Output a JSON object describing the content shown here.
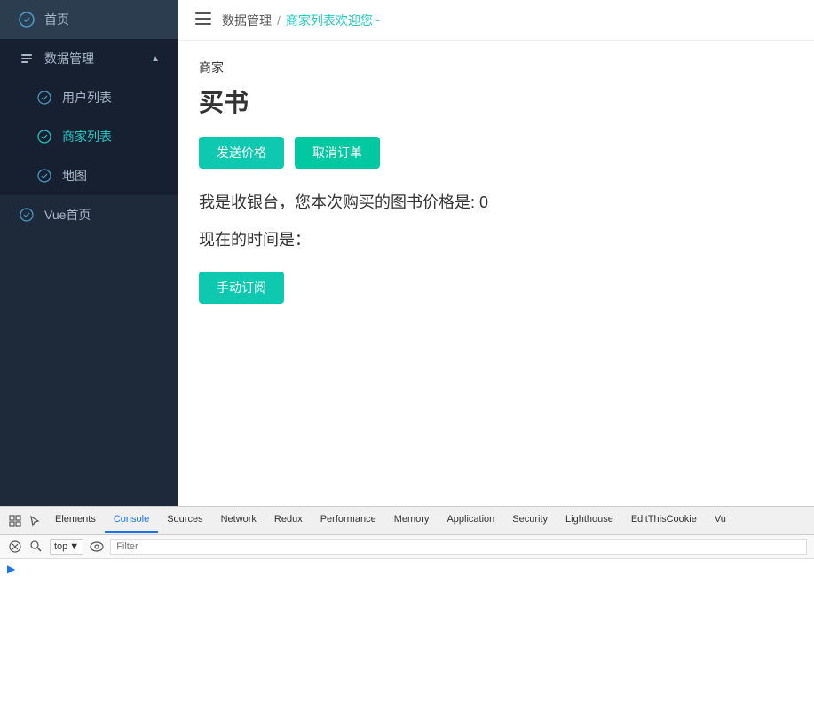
{
  "sidebar": {
    "logo": {
      "icon": "⊕",
      "text": "首页"
    },
    "items": [
      {
        "id": "home",
        "label": "首页",
        "icon": "⊕",
        "active": false
      },
      {
        "id": "data-management",
        "label": "数据管理",
        "icon": "📄",
        "active": true,
        "expanded": true
      },
      {
        "id": "user-list",
        "label": "用户列表",
        "icon": "⊕",
        "submenu": true,
        "active": false
      },
      {
        "id": "merchant-list",
        "label": "商家列表",
        "icon": "⊕",
        "submenu": true,
        "active": true
      },
      {
        "id": "map",
        "label": "地图",
        "icon": "⊕",
        "submenu": true,
        "active": false
      },
      {
        "id": "vue-home",
        "label": "Vue首页",
        "icon": "⊕",
        "active": false
      }
    ]
  },
  "topbar": {
    "breadcrumb": {
      "parent": "数据管理",
      "separator": "/",
      "current": "商家列表",
      "suffix": "欢迎您~"
    },
    "hamburger_label": "≡"
  },
  "page": {
    "subtitle": "商家",
    "title": "买书",
    "send_price_btn": "发送价格",
    "cancel_order_btn": "取消订单",
    "price_text": "我是收银台，您本次购买的图书价格是: 0",
    "time_text": "现在的时间是：",
    "manual_order_btn": "手动订阅"
  },
  "devtools": {
    "tabs": [
      {
        "id": "elements",
        "label": "Elements",
        "active": false
      },
      {
        "id": "console",
        "label": "Console",
        "active": true
      },
      {
        "id": "sources",
        "label": "Sources",
        "active": false
      },
      {
        "id": "network",
        "label": "Network",
        "active": false
      },
      {
        "id": "redux",
        "label": "Redux",
        "active": false
      },
      {
        "id": "performance",
        "label": "Performance",
        "active": false
      },
      {
        "id": "memory",
        "label": "Memory",
        "active": false
      },
      {
        "id": "application",
        "label": "Application",
        "active": false
      },
      {
        "id": "security",
        "label": "Security",
        "active": false
      },
      {
        "id": "lighthouse",
        "label": "Lighthouse",
        "active": false
      },
      {
        "id": "edit-cookie",
        "label": "EditThisCookie",
        "active": false
      },
      {
        "id": "vue",
        "label": "Vu",
        "active": false
      }
    ],
    "toolbar": {
      "context_selector": "top",
      "filter_placeholder": "Filter"
    }
  }
}
